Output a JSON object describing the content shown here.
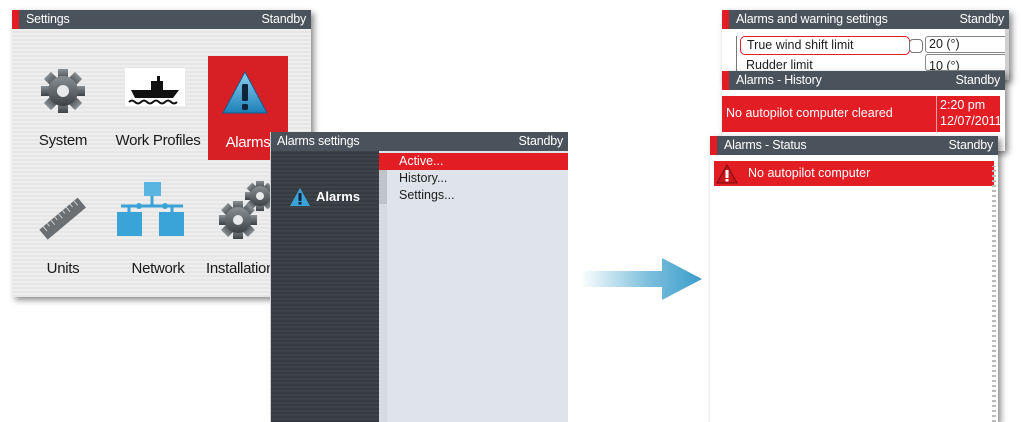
{
  "settings_panel": {
    "title": "Settings",
    "status": "Standby",
    "tiles": [
      {
        "label": "System",
        "icon": "gear-icon"
      },
      {
        "label": "Work Profiles",
        "icon": "boat-icon"
      },
      {
        "label": "Alarms",
        "icon": "warning-triangle-icon",
        "selected": true
      },
      {
        "label": "Units",
        "icon": "ruler-icon"
      },
      {
        "label": "Network",
        "icon": "network-icon"
      },
      {
        "label": "Installation",
        "icon": "gears-icon"
      }
    ]
  },
  "alarms_settings_panel": {
    "title": "Alarms settings",
    "status": "Standby",
    "category": "Alarms",
    "menu": [
      {
        "label": "Active...",
        "active": true
      },
      {
        "label": "History...",
        "active": false
      },
      {
        "label": "Settings...",
        "active": false
      }
    ]
  },
  "warning_settings_panel": {
    "title": "Alarms and warning settings",
    "status": "Standby",
    "rows": [
      {
        "label": "True wind shift limit",
        "value": "20 (°)"
      },
      {
        "label": "Rudder limit",
        "value": "10 (°)"
      }
    ]
  },
  "history_panel": {
    "title": "Alarms - History",
    "status": "Standby",
    "entry": {
      "text": "No autopilot computer cleared",
      "time": "2:20 pm",
      "date": "12/07/2011"
    }
  },
  "status_panel": {
    "title": "Alarms - Status",
    "status": "Standby",
    "entry": {
      "text": "No autopilot computer"
    }
  },
  "colors": {
    "accent": "#e21d24",
    "titlebar": "#4a535b",
    "arrow": "#5aa9cf"
  }
}
